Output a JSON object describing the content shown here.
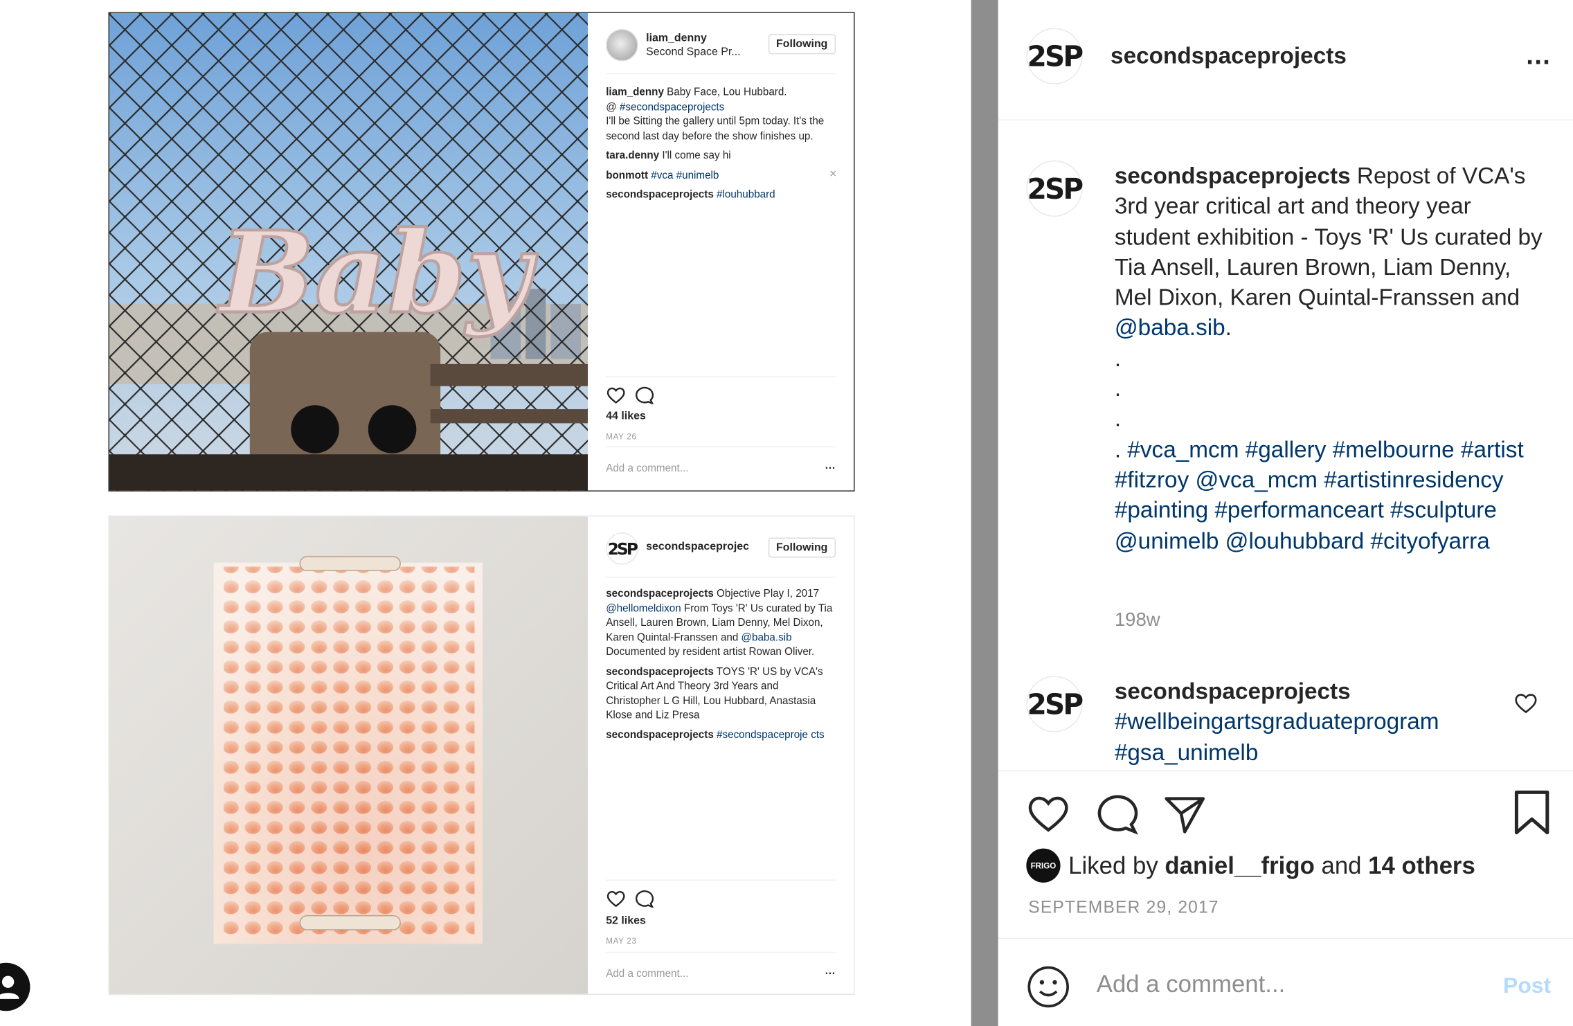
{
  "left": {
    "post1": {
      "username": "liam_denny",
      "subtitle": "Second Space Pr...",
      "follow_label": "Following",
      "captions": [
        {
          "user": "liam_denny",
          "text": "Baby Face, Lou Hubbard.",
          "line2_prefix": "@ ",
          "link": "#secondspaceprojects",
          "rest": "I'll be Sitting the gallery until 5pm today. It's the second last day before the show finishes up."
        },
        {
          "user": "tara.denny",
          "text": "I'll come say hi"
        },
        {
          "user": "bonmott",
          "link": "#vca #unimelb"
        },
        {
          "user": "secondspaceprojects",
          "link": "#louhubbard"
        }
      ],
      "likes": "44 likes",
      "date": "MAY 26",
      "comment_placeholder": "Add a comment...",
      "photo_text": "Baby"
    },
    "post2": {
      "logo": "2SP",
      "username": "secondspaceprojec",
      "follow_label": "Following",
      "c1_user": "secondspaceprojects",
      "c1_text": "Objective Play I, 2017",
      "c1_link": "@hellomeldixon",
      "c1_text2": "From Toys 'R' Us curated by Tia Ansell, Lauren Brown, Liam Denny, Mel Dixon, Karen Quintal-Franssen and",
      "c1_link2": "@baba.sib",
      "c1_text3": "Documented by resident artist Rowan Oliver.",
      "c2_user": "secondspaceprojects",
      "c2_text": "TOYS 'R' US by VCA's Critical Art And Theory 3rd Years and Christopher L G Hill, Lou Hubbard, Anastasia Klose and Liz Presa",
      "c3_user": "secondspaceprojects",
      "c3_link": "#secondspaceproje cts",
      "likes": "52 likes",
      "date": "MAY 23",
      "comment_placeholder": "Add a comment..."
    }
  },
  "panel": {
    "logo": "2SP",
    "username": "secondspaceprojects",
    "more_icon": "...",
    "caption_user": "secondspaceprojects",
    "caption_text": "Repost of VCA's 3rd year critical art and theory year student exhibition - Toys 'R' Us curated by Tia Ansell, Lauren Brown, Liam Denny, Mel Dixon, Karen Quintal-Franssen and",
    "caption_mention": "@baba.sib",
    "caption_end": ".",
    "dots": [
      ".",
      ".",
      "."
    ],
    "dot_lead": ". ",
    "hashtags": "#vca_mcm #gallery #melbourne #artist #fitzroy @vca_mcm #artistinresidency #painting #performanceart #sculpture @unimelb @louhubbard #cityofyarra",
    "time": "198w",
    "comment_user": "secondspaceprojects",
    "comment_tags": "#wellbeingartsgraduateprogram #gsa_unimelb",
    "liked_avatar": "FRIGO",
    "liked_prefix": "Liked by",
    "liked_user": "daniel__frigo",
    "liked_and": "and",
    "liked_others": "14 others",
    "date": "SEPTEMBER 29, 2017",
    "comment_placeholder": "Add a comment...",
    "post_label": "Post"
  },
  "colors": {
    "link": "#00376b",
    "post_disabled": "#b3dbff",
    "divider": "#8e8e8e"
  }
}
